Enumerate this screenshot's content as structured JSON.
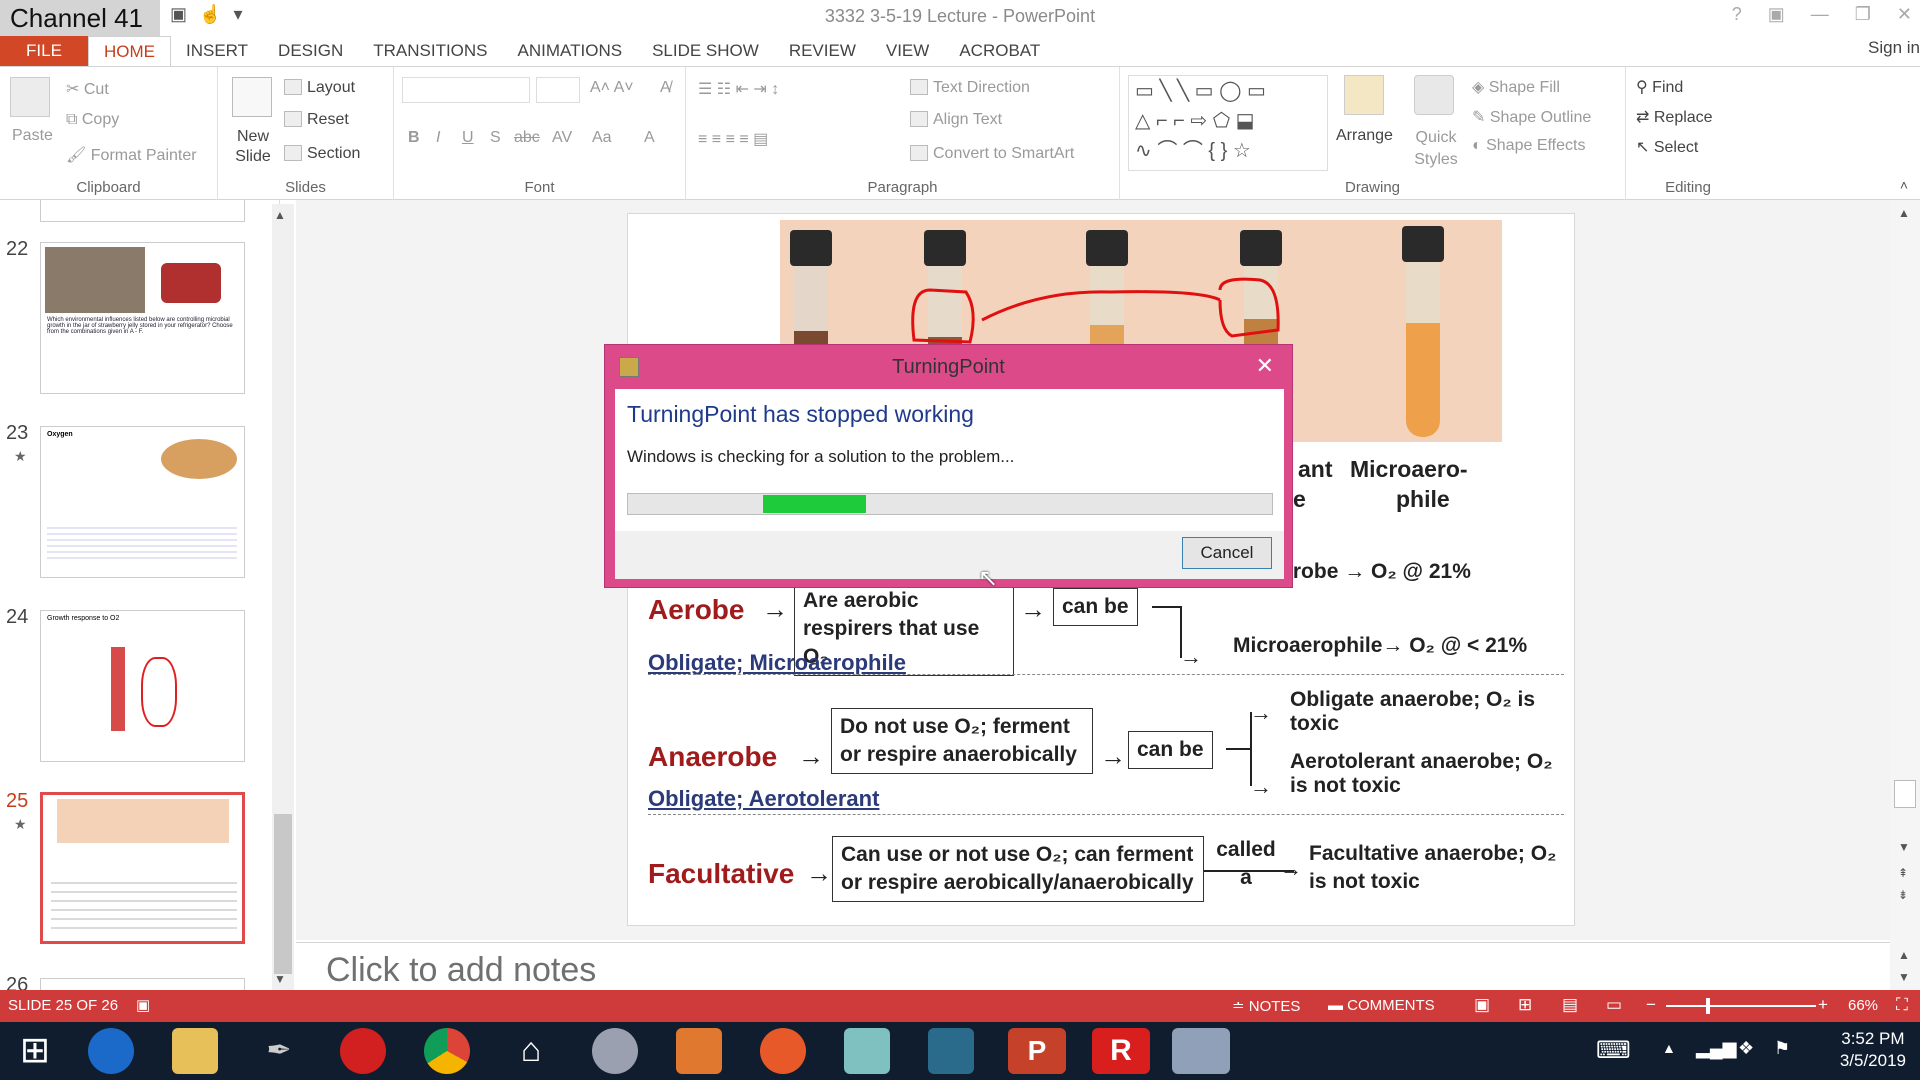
{
  "titlebar": {
    "channel": "Channel 41",
    "document_title": "3332 3-5-19 Lecture - PowerPoint",
    "controls": [
      "?",
      "▣",
      "—",
      "❐",
      "✕"
    ]
  },
  "ribbon_tabs": [
    "FILE",
    "HOME",
    "INSERT",
    "DESIGN",
    "TRANSITIONS",
    "ANIMATIONS",
    "SLIDE SHOW",
    "REVIEW",
    "VIEW",
    "ACROBAT"
  ],
  "sign_in": "Sign in",
  "ribbon": {
    "clipboard": {
      "paste": "Paste",
      "cut": "Cut",
      "copy": "Copy",
      "format_painter": "Format Painter",
      "label": "Clipboard"
    },
    "slides": {
      "new_slide": "New Slide",
      "layout": "Layout",
      "reset": "Reset",
      "section": "Section",
      "label": "Slides"
    },
    "font": {
      "bold": "B",
      "italic": "I",
      "underline": "U",
      "shadow": "S",
      "strike": "abc",
      "spacing": "AV",
      "case": "Aa",
      "label": "Font"
    },
    "paragraph": {
      "text_direction": "Text Direction",
      "align_text": "Align Text",
      "convert_smartart": "Convert to SmartArt",
      "label": "Paragraph"
    },
    "drawing": {
      "arrange": "Arrange",
      "quick_styles": "Quick Styles",
      "shape_fill": "Shape Fill",
      "shape_outline": "Shape Outline",
      "shape_effects": "Shape Effects",
      "label": "Drawing"
    },
    "editing": {
      "find": "Find",
      "replace": "Replace",
      "select": "Select",
      "label": "Editing"
    }
  },
  "slide_panel": {
    "slides": [
      {
        "num": "22",
        "star": false,
        "caption": "Which environmental influences listed below are controlling microbial growth in the jar of strawberry jelly stored in your refrigerator? Choose from the combinations given in A - F."
      },
      {
        "num": "23",
        "star": true,
        "caption": "Oxygen"
      },
      {
        "num": "24",
        "star": false,
        "caption": "Growth response to O2"
      },
      {
        "num": "25",
        "star": true,
        "caption": ""
      },
      {
        "num": "26",
        "star": false,
        "caption": ""
      }
    ]
  },
  "slide": {
    "tube_labels": [
      "ant",
      "e",
      "Microaero-",
      "phile"
    ],
    "aerobe": {
      "title": "Aerobe",
      "box": "Are aerobic respirers that use O₂",
      "can_be": "can be",
      "out1": "te aerobe → O₂ @ 21%",
      "out2": "Microaerophile→ O₂ @ < 21%",
      "types": "Obligate;  Microaerophile"
    },
    "anaerobe": {
      "title": "Anaerobe",
      "box": "Do not use O₂; ferment or respire anaerobically",
      "can_be": "can be",
      "out1": "Obligate anaerobe; O₂ is toxic",
      "out2": "Aerotolerant anaerobe; O₂ is not toxic",
      "types": "Obligate;  Aerotolerant"
    },
    "facultative": {
      "title": "Facultative",
      "box": "Can use or not use O₂; can ferment or respire aerobically/anaerobically",
      "called": "called a",
      "out": "Facultative anaerobe; O₂ is not toxic"
    }
  },
  "notes_placeholder": "Click to add notes",
  "dialog": {
    "title": "TurningPoint",
    "heading": "TurningPoint has stopped working",
    "message": "Windows is checking for a solution to the problem...",
    "cancel": "Cancel",
    "progress_start": 0.21,
    "progress_end": 0.37
  },
  "statusbar": {
    "slide_info": "SLIDE 25 OF 26",
    "notes": "NOTES",
    "comments": "COMMENTS",
    "zoom": "66%"
  },
  "taskbar": {
    "time": "3:52 PM",
    "date": "3/5/2019"
  },
  "colors": {
    "accent": "#d24726",
    "status_bar": "#cf3b3b",
    "dialog_frame": "#dc4a8a",
    "progress": "#1ecb3a",
    "slide_red": "#a01c1c",
    "slide_blue": "#2b3a78"
  }
}
